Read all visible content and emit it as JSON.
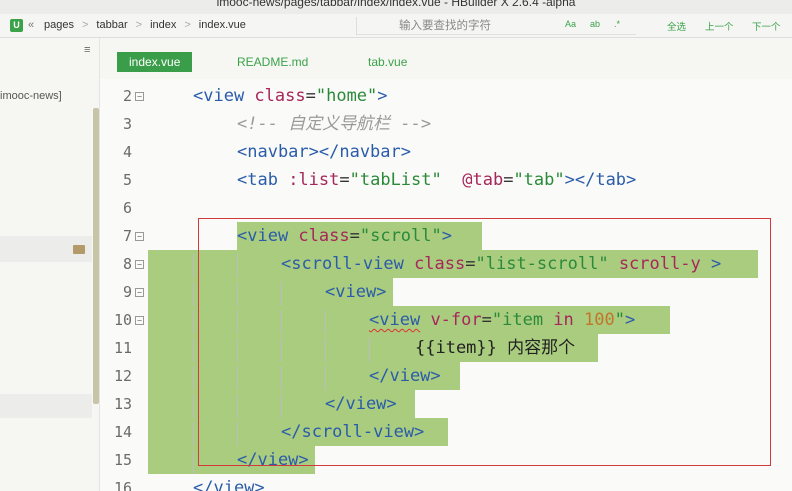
{
  "window": {
    "title": "imooc-news/pages/tabbar/index/index.vue - HBuilder X 2.6.4 -alpha"
  },
  "toolbar": {
    "app_icon": "U",
    "nav_back": "«",
    "breadcrumb": [
      "pages",
      "tabbar",
      "index",
      "index.vue"
    ],
    "breadcrumb_sep": ">",
    "search_placeholder": "输入要查找的字符",
    "options": [
      "Aa",
      "ab",
      ".*"
    ],
    "select_all": "全选",
    "prev": "上一个",
    "next": "下一个"
  },
  "sidebar": {
    "menu_icon": "≡",
    "project_label": "imooc-news]"
  },
  "tabs": [
    {
      "label": "index.vue",
      "active": true
    },
    {
      "label": "README.md",
      "active": false
    },
    {
      "label": "tab.vue",
      "active": false
    }
  ],
  "colors": {
    "accent": "#3aa34a",
    "highlight": "#a9cc7e",
    "selection_border": "#d03a3a",
    "tag": "#2a5caa",
    "attr": "#a6275a",
    "string": "#2a8a3a"
  },
  "code_lines": [
    {
      "n": "2",
      "fold": true,
      "tokens": [
        [
          "tag",
          "<view "
        ],
        [
          "attr",
          "class"
        ],
        [
          "eq",
          "="
        ],
        [
          "str",
          "\"home\""
        ],
        [
          "tag",
          ">"
        ]
      ]
    },
    {
      "n": "3",
      "fold": false,
      "tokens": [
        [
          "comment",
          "<!-- 自定义导航栏 -->"
        ]
      ]
    },
    {
      "n": "4",
      "fold": false,
      "tokens": [
        [
          "tag",
          "<navbar></navbar>"
        ]
      ]
    },
    {
      "n": "5",
      "fold": false,
      "tokens": [
        [
          "tag",
          "<tab "
        ],
        [
          "attr",
          ":list"
        ],
        [
          "eq",
          "="
        ],
        [
          "str",
          "\"tabList\""
        ],
        [
          "text",
          "  "
        ],
        [
          "attr",
          "@tab"
        ],
        [
          "eq",
          "="
        ],
        [
          "str",
          "\"tab\""
        ],
        [
          "tag",
          "></tab>"
        ]
      ]
    },
    {
      "n": "6",
      "fold": false,
      "tokens": []
    },
    {
      "n": "7",
      "fold": true,
      "tokens": [
        [
          "tag",
          "<view "
        ],
        [
          "attr",
          "class"
        ],
        [
          "eq",
          "="
        ],
        [
          "str",
          "\"scroll\""
        ],
        [
          "tag",
          ">"
        ]
      ]
    },
    {
      "n": "8",
      "fold": true,
      "tokens": [
        [
          "tag",
          "<scroll-view "
        ],
        [
          "attr",
          "class"
        ],
        [
          "eq",
          "="
        ],
        [
          "str",
          "\"list-scroll\""
        ],
        [
          "text",
          " "
        ],
        [
          "attr",
          "scroll-y"
        ],
        [
          "text",
          " "
        ],
        [
          "tag",
          ">"
        ]
      ]
    },
    {
      "n": "9",
      "fold": true,
      "tokens": [
        [
          "tag",
          "<view>"
        ]
      ]
    },
    {
      "n": "10",
      "fold": true,
      "tokens": [
        [
          "tagsq",
          "<view"
        ],
        [
          "text",
          " "
        ],
        [
          "attr",
          "v-for"
        ],
        [
          "eq",
          "="
        ],
        [
          "str",
          "\"item "
        ],
        [
          "kw",
          "in"
        ],
        [
          "str",
          " "
        ],
        [
          "num",
          "100"
        ],
        [
          "str",
          "\""
        ],
        [
          "tag",
          ">"
        ]
      ]
    },
    {
      "n": "11",
      "fold": false,
      "tokens": [
        [
          "text",
          "{{item}} 内容那个"
        ]
      ]
    },
    {
      "n": "12",
      "fold": false,
      "tokens": [
        [
          "tag",
          "</view>"
        ]
      ]
    },
    {
      "n": "13",
      "fold": false,
      "tokens": [
        [
          "tag",
          "</view>"
        ]
      ]
    },
    {
      "n": "14",
      "fold": false,
      "tokens": [
        [
          "tag",
          "</scroll-view>"
        ]
      ]
    },
    {
      "n": "15",
      "fold": false,
      "tokens": [
        [
          "tag",
          "</view>"
        ]
      ]
    },
    {
      "n": "16",
      "fold": false,
      "tokens": [
        [
          "tag",
          "</view>"
        ]
      ]
    }
  ]
}
